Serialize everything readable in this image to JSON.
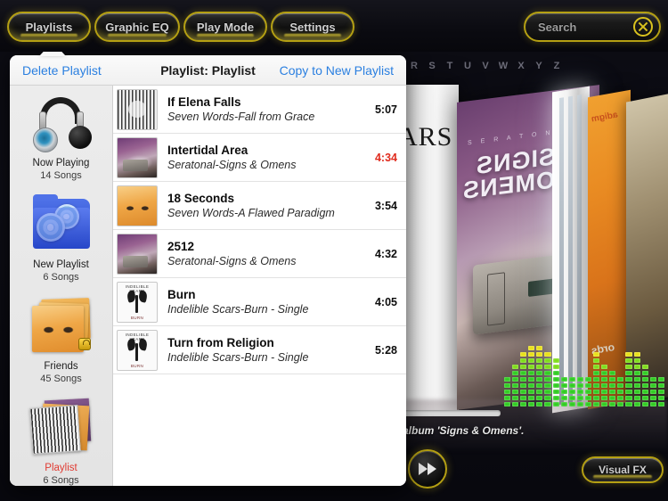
{
  "toolbar": {
    "buttons": [
      {
        "label": "Playlists",
        "name": "playlists"
      },
      {
        "label": "Graphic EQ",
        "name": "graphic-eq"
      },
      {
        "label": "Play Mode",
        "name": "play-mode"
      },
      {
        "label": "Settings",
        "name": "settings"
      }
    ],
    "search": {
      "placeholder": "Search",
      "value": "Search",
      "clear_icon": "circle-x-icon"
    }
  },
  "alphabet_index": [
    "R",
    "S",
    "T",
    "U",
    "V",
    "W",
    "X",
    "Y",
    "Z"
  ],
  "panel": {
    "delete_label": "Delete Playlist",
    "title": "Playlist: Playlist",
    "copy_label": "Copy to New Playlist"
  },
  "sidebar": {
    "items": [
      {
        "name": "now-playing",
        "label": "Now Playing",
        "count": "14 Songs",
        "icon": "headphones-icon",
        "selected": false
      },
      {
        "name": "new-playlist",
        "label": "New Playlist",
        "count": "6 Songs",
        "icon": "blue-folder-cd-icon",
        "selected": false
      },
      {
        "name": "friends",
        "label": "Friends",
        "count": "45 Songs",
        "icon": "photo-stack-icon",
        "selected": false,
        "locked": true
      },
      {
        "name": "playlist",
        "label": "Playlist",
        "count": "6 Songs",
        "icon": "album-stack-icon",
        "selected": true
      }
    ]
  },
  "tracks": [
    {
      "title": "If Elena Falls",
      "subtitle": "Seven Words-Fall from Grace",
      "duration": "5:07",
      "art": "barcode",
      "playing": false
    },
    {
      "title": "Intertidal Area",
      "subtitle": "Seratonal-Signs & Omens",
      "duration": "4:34",
      "art": "signs",
      "playing": true
    },
    {
      "title": "18 Seconds",
      "subtitle": "Seven Words-A Flawed Paradigm",
      "duration": "3:54",
      "art": "eyes",
      "playing": false
    },
    {
      "title": "2512",
      "subtitle": "Seratonal-Signs & Omens",
      "duration": "4:32",
      "art": "signs",
      "playing": false
    },
    {
      "title": "Burn",
      "subtitle": "Indelible Scars-Burn - Single",
      "duration": "4:05",
      "art": "scars",
      "playing": false
    },
    {
      "title": "Turn from Religion",
      "subtitle": "Indelible Scars-Burn - Single",
      "duration": "5:28",
      "art": "scars",
      "playing": false
    }
  ],
  "album_art_labels": {
    "scars_top": "INDELIBLE SCARS",
    "scars_bottom": "BURN"
  },
  "now_playing": {
    "text": "album 'Signs & Omens'.",
    "next_icon": "fast-forward-icon",
    "visual_fx_label": "Visual FX"
  },
  "coverflow": {
    "left_label": "ARS",
    "main_top": "S E R A T O N A L",
    "main_title": "SIGNS\nOMENS",
    "orange_word": "adigm",
    "orange_word2": "ords"
  },
  "spectrum": {
    "levels": [
      5,
      7,
      9,
      10,
      10,
      9,
      8,
      5,
      5,
      5,
      5,
      9,
      7,
      6,
      5,
      9,
      9,
      7,
      5,
      5
    ],
    "colors": {
      "low": "#2ecc1f",
      "mid": "#7ddc17",
      "high": "#e8e016"
    }
  },
  "colors": {
    "accent_gold": "#b5a013",
    "link_blue": "#2a7fe0",
    "playing_red": "#e02b1e",
    "selected_red": "#e03b32"
  }
}
